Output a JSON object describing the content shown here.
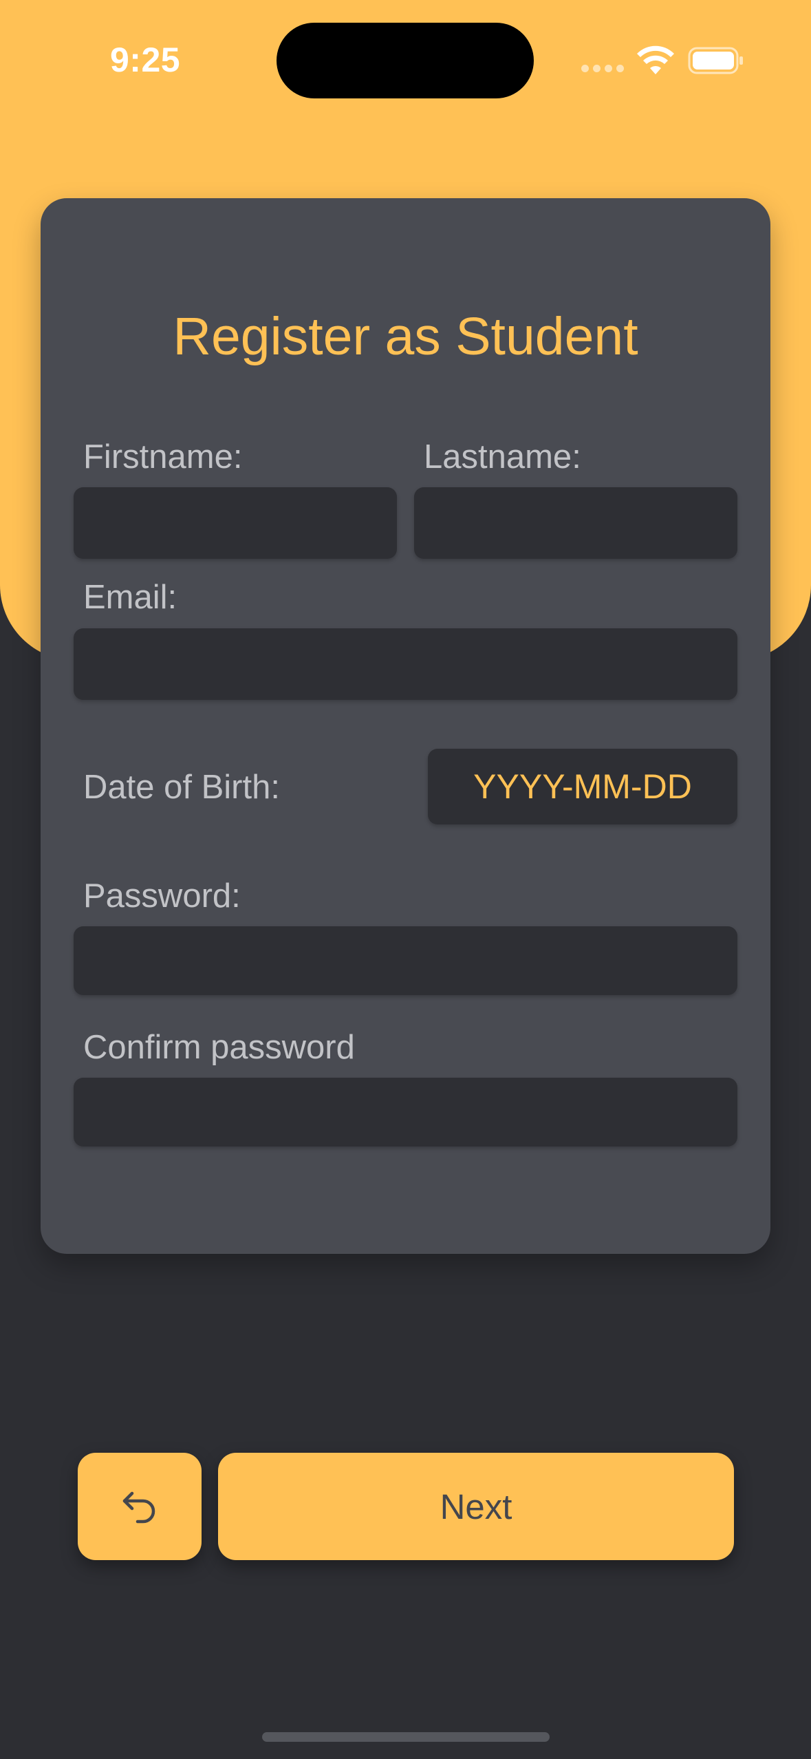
{
  "status_bar": {
    "time": "9:25"
  },
  "form": {
    "title": "Register as Student",
    "firstname_label": "Firstname:",
    "lastname_label": "Lastname:",
    "email_label": "Email:",
    "dob_label": "Date of Birth:",
    "dob_value": "YYYY-MM-DD",
    "password_label": "Password:",
    "confirm_password_label": "Confirm password",
    "firstname_value": "",
    "lastname_value": "",
    "email_value": "",
    "password_value": "",
    "confirm_password_value": ""
  },
  "actions": {
    "back_icon": "undo-arrow-icon",
    "next_label": "Next"
  },
  "colors": {
    "accent": "#ffc155",
    "background": "#2d2e33",
    "card": "#494b52",
    "input": "#2e2f34",
    "label": "#c2c3c7"
  }
}
